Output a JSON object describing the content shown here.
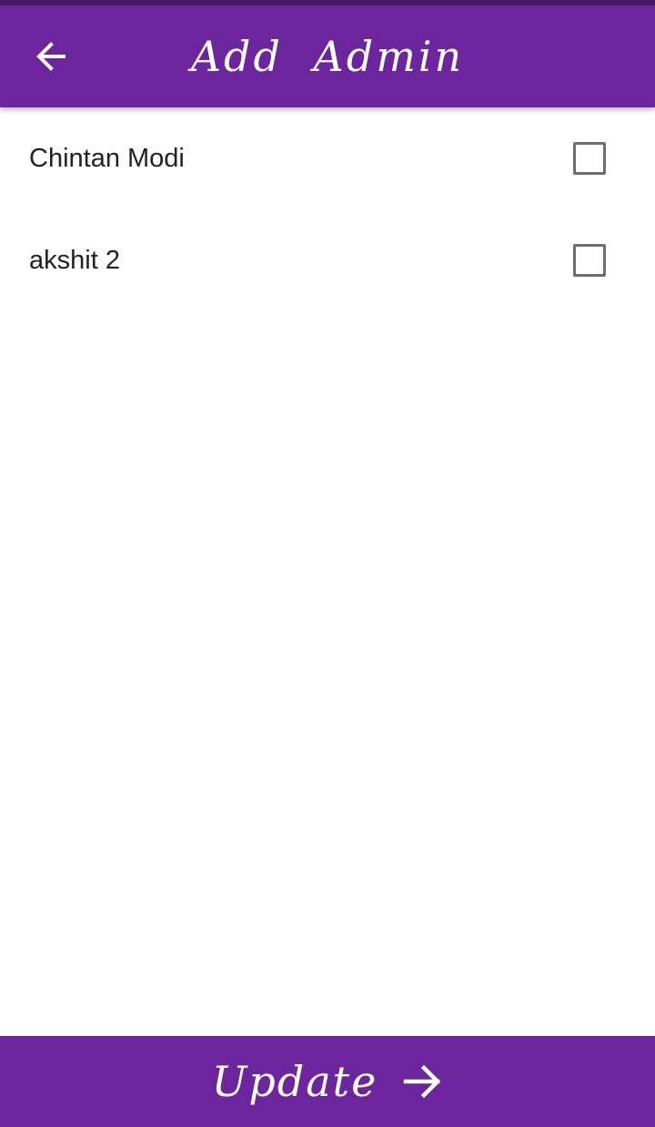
{
  "app_bar": {
    "title": "Add  Admin",
    "back_icon": "arrow-left-icon",
    "color": "#6c259c"
  },
  "users": [
    {
      "name": "Chintan Modi",
      "checked": false
    },
    {
      "name": "akshit 2",
      "checked": false
    }
  ],
  "footer": {
    "update_label": "Update",
    "icon": "arrow-right-icon",
    "color": "#6c259c"
  }
}
